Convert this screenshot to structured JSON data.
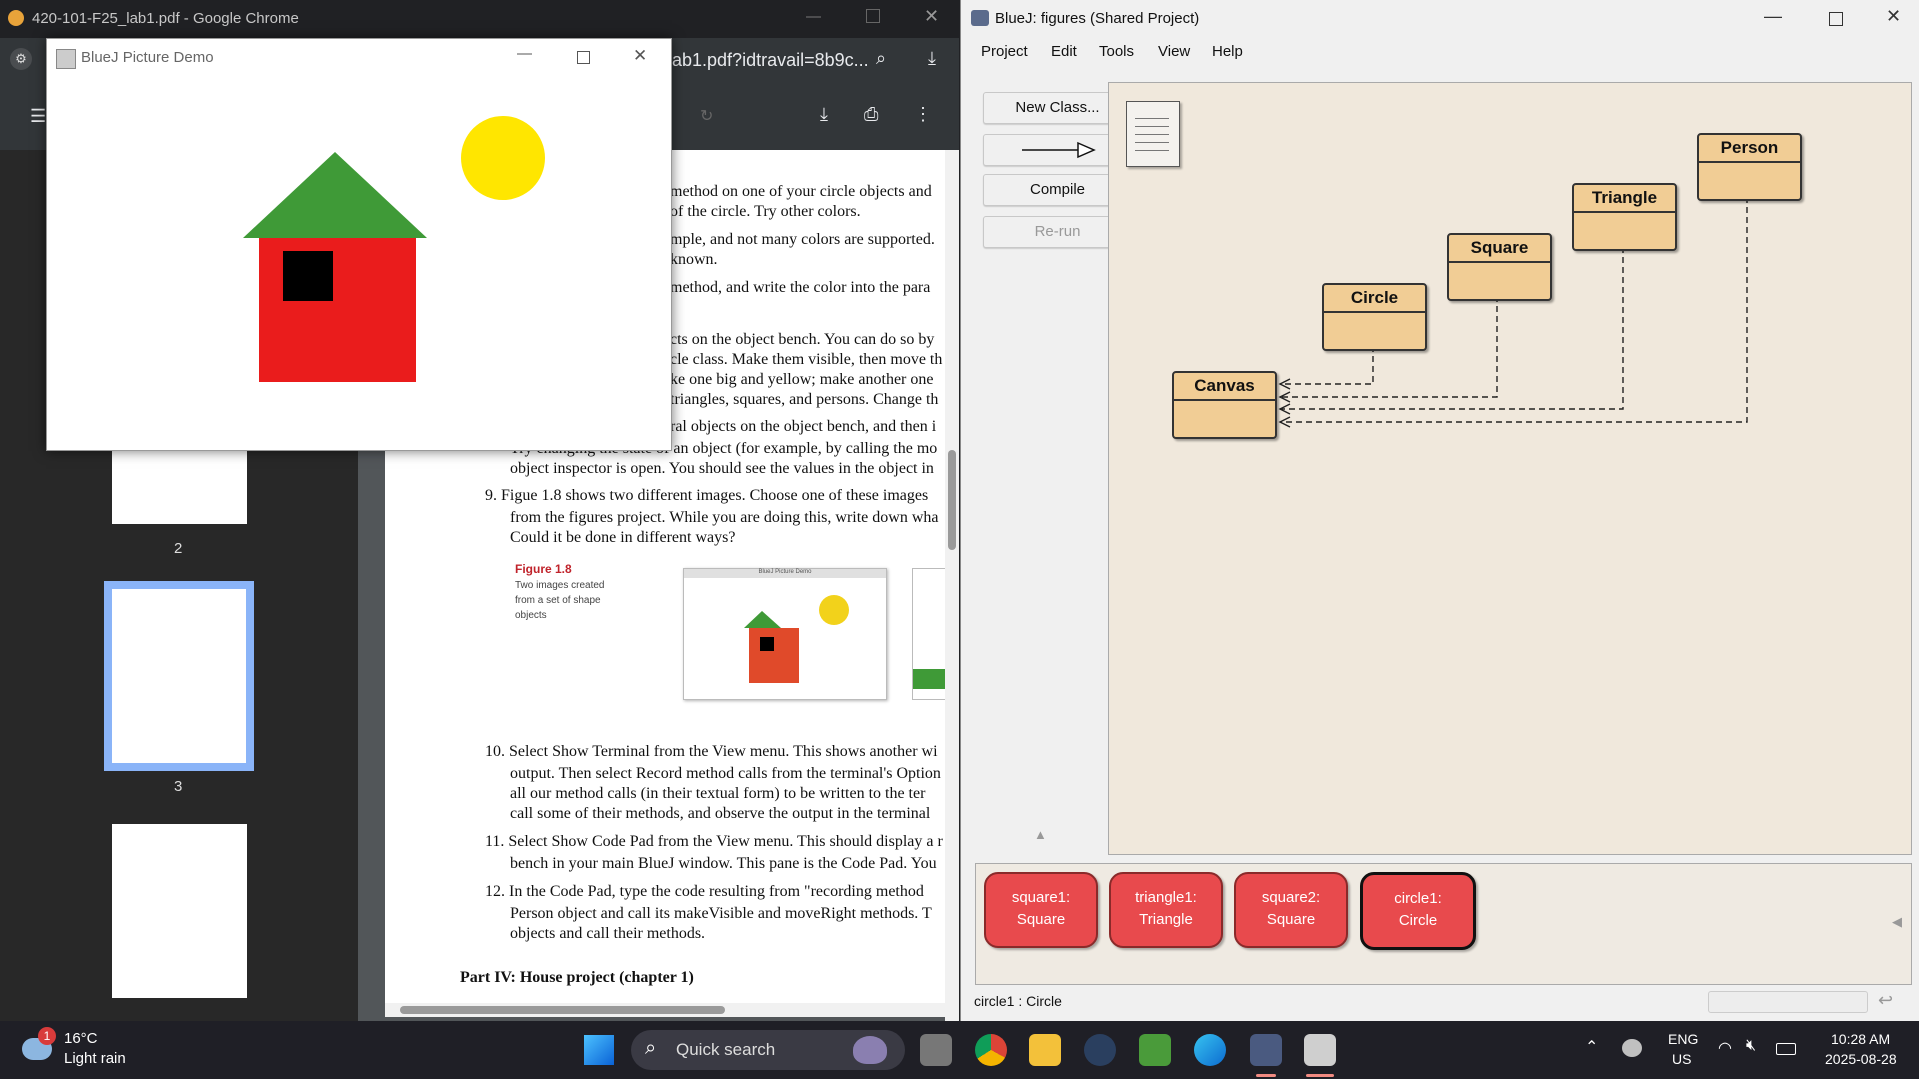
{
  "chrome": {
    "tab_title": "420-101-F25_lab1.pdf - Google Chrome",
    "url_fragment": "ab1.pdf?idtravail=8b9c...",
    "page_numbers": [
      "2",
      "3"
    ],
    "pdf_lines": [
      "method on one of your circle objects and",
      "of the circle. Try other colors.",
      "mple, and not many colors are supported.",
      "known.",
      "method, and write the color into the para",
      "cts on the object bench. You can do so by",
      "cle class. Make them visible, then move th",
      "ke one big and yellow; make another one",
      "triangles, squares, and persons. Change th",
      "ral objects on the object bench, and then i",
      "Try changing the state of an object (for example, by calling the mo",
      "object inspector is open. You should see the values in the object in",
      "9.  Figue 1.8 shows two different images. Choose one of these images",
      "from the figures project. While you are doing this, write down wha",
      "Could it be done in different ways?",
      "10. Select Show Terminal from the View menu. This shows another wi",
      "output. Then select Record method calls from the terminal's Option",
      "all our method calls (in their textual form) to be written to the ter",
      "call some of their methods, and observe the output in the terminal",
      "11. Select Show Code Pad from the View menu. This should display a r",
      "bench in your main BlueJ window. This pane is the Code Pad. You",
      "12. In the Code Pad, type the code resulting from \"recording method",
      "Person object and call its makeVisible and moveRight methods. T",
      "objects and call their methods."
    ],
    "part_heading": "Part IV: House project (chapter 1)",
    "figure_label": "Figure 1.8",
    "figure_caption": "Two images created from a set of shape objects",
    "figure_window_title": "BlueJ Picture Demo"
  },
  "demo": {
    "title": "BlueJ Picture Demo"
  },
  "bluej": {
    "title": "BlueJ:  figures (Shared Project)",
    "menu": [
      "Project",
      "Edit",
      "Tools",
      "View",
      "Help"
    ],
    "buttons": {
      "new_class": "New Class...",
      "compile": "Compile",
      "rerun": "Re-run"
    },
    "classes": {
      "canvas": "Canvas",
      "circle": "Circle",
      "square": "Square",
      "triangle": "Triangle",
      "person": "Person"
    },
    "objects": [
      {
        "line1": "square1:",
        "line2": "Square"
      },
      {
        "line1": "triangle1:",
        "line2": "Triangle"
      },
      {
        "line1": "square2:",
        "line2": "Square"
      },
      {
        "line1": "circle1:",
        "line2": "Circle"
      }
    ],
    "status": "circle1 : Circle"
  },
  "taskbar": {
    "temp": "16°C",
    "weather": "Light rain",
    "weather_badge": "1",
    "search": "Quick search",
    "lang1": "ENG",
    "lang2": "US",
    "time": "10:28 AM",
    "date": "2025-08-28"
  },
  "colors": {
    "class_fill": "#f1cd95",
    "object_fill": "#e84a4d",
    "house_wall": "#ea1c1c",
    "roof": "#3f9a37",
    "sun": "#ffe600"
  }
}
